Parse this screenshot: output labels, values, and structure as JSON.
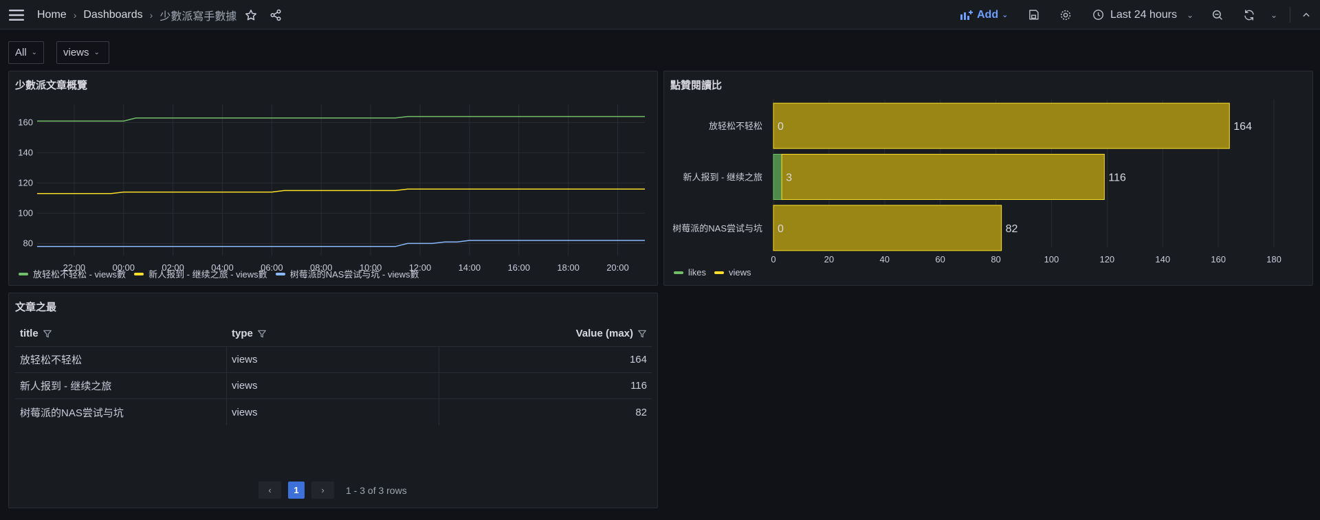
{
  "topbar": {
    "breadcrumb": [
      "Home",
      "Dashboards",
      "少數派寫手數據"
    ],
    "add_label": "Add",
    "time_range": "Last 24 hours"
  },
  "variables": {
    "var1": "All",
    "var2": "views"
  },
  "panels": {
    "timeseries_title": "少數派文章概覽",
    "barchart_title": "點贊閱讀比",
    "table_title": "文章之最"
  },
  "colors": {
    "green": "#73bf69",
    "yellow": "#fade2a",
    "blue": "#8ab8ff",
    "accent": "#6e9fff"
  },
  "chart_data": [
    {
      "type": "line",
      "title": "少數派文章概覽",
      "x_ticks": [
        "22:00",
        "00:00",
        "02:00",
        "04:00",
        "06:00",
        "08:00",
        "10:00",
        "12:00",
        "14:00",
        "16:00",
        "18:00",
        "20:00"
      ],
      "y_ticks": [
        80,
        100,
        120,
        140,
        160
      ],
      "ylim": [
        72,
        172
      ],
      "x_range_hours": [
        -1.5,
        23.1
      ],
      "series": [
        {
          "name": "放轻松不轻松 - views數",
          "color": "#73bf69",
          "points": [
            [
              -1.5,
              161
            ],
            [
              2.0,
              161
            ],
            [
              2.5,
              163
            ],
            [
              13.0,
              163
            ],
            [
              13.5,
              164
            ],
            [
              23.1,
              164
            ]
          ]
        },
        {
          "name": "新人报到 - 继续之旅 - views數",
          "color": "#fade2a",
          "points": [
            [
              -1.5,
              113
            ],
            [
              1.5,
              113
            ],
            [
              2.0,
              114
            ],
            [
              8.0,
              114
            ],
            [
              8.5,
              115
            ],
            [
              13.0,
              115
            ],
            [
              13.5,
              116
            ],
            [
              23.1,
              116
            ]
          ]
        },
        {
          "name": "树莓派的NAS尝试与坑 - views數",
          "color": "#8ab8ff",
          "points": [
            [
              -1.5,
              78
            ],
            [
              13.0,
              78
            ],
            [
              13.5,
              80
            ],
            [
              14.5,
              80
            ],
            [
              15.0,
              81
            ],
            [
              15.5,
              81
            ],
            [
              16.0,
              82
            ],
            [
              23.1,
              82
            ]
          ]
        }
      ]
    },
    {
      "type": "bar",
      "orientation": "horizontal",
      "stacked": true,
      "title": "點贊閱讀比",
      "categories": [
        "放轻松不轻松",
        "新人报到 - 继续之旅",
        "树莓派的NAS尝试与坑"
      ],
      "x_ticks": [
        0,
        20,
        40,
        60,
        80,
        100,
        120,
        140,
        160,
        180
      ],
      "xlim": [
        0,
        180
      ],
      "series": [
        {
          "name": "likes",
          "color": "#73bf69",
          "values": [
            0,
            3,
            0
          ]
        },
        {
          "name": "views",
          "color": "#fade2a",
          "values": [
            164,
            116,
            82
          ]
        }
      ],
      "bar_labels": {
        "likes": [
          "0",
          "3",
          "0"
        ],
        "views": [
          "164",
          "116",
          "82"
        ]
      }
    }
  ],
  "table": {
    "headers": [
      "title",
      "type",
      "Value (max)"
    ],
    "rows": [
      [
        "放轻松不轻松",
        "views",
        "164"
      ],
      [
        "新人报到 - 继续之旅",
        "views",
        "116"
      ],
      [
        "树莓派的NAS尝试与坑",
        "views",
        "82"
      ]
    ],
    "pagination": {
      "current_page": "1",
      "info": "1 - 3 of 3 rows"
    }
  }
}
